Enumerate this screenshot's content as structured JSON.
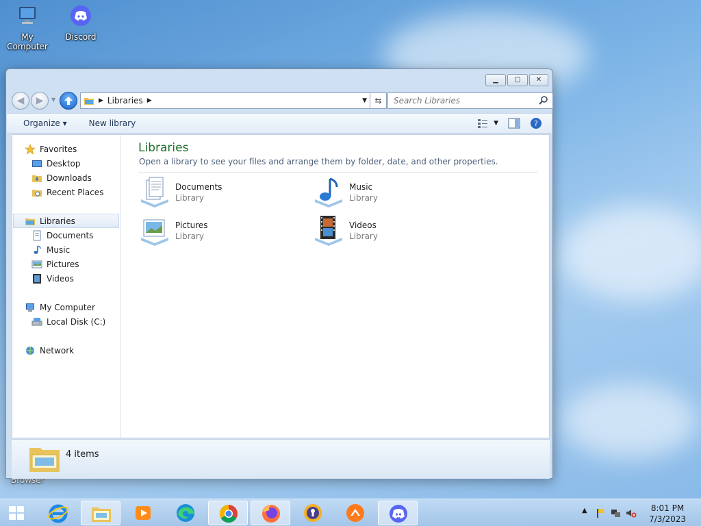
{
  "desktop": {
    "icons": [
      {
        "label": "My Computer"
      },
      {
        "label": "Discord"
      }
    ],
    "partial_label": "Browser"
  },
  "window": {
    "address": {
      "crumb": "Libraries"
    },
    "search_placeholder": "Search Libraries",
    "toolbar": {
      "organize": "Organize ▾",
      "new_library": "New library"
    },
    "nav": {
      "favorites": "Favorites",
      "desktop": "Desktop",
      "downloads": "Downloads",
      "recent_places": "Recent Places",
      "libraries": "Libraries",
      "documents": "Documents",
      "music": "Music",
      "pictures": "Pictures",
      "videos": "Videos",
      "my_computer": "My Computer",
      "local_disk": "Local Disk (C:)",
      "network": "Network"
    },
    "main": {
      "title": "Libraries",
      "subtitle": "Open a library to see your files and arrange them by folder, date, and other properties.",
      "libraries": [
        {
          "name": "Documents",
          "type": "Library"
        },
        {
          "name": "Music",
          "type": "Library"
        },
        {
          "name": "Pictures",
          "type": "Library"
        },
        {
          "name": "Videos",
          "type": "Library"
        }
      ]
    },
    "status": {
      "count": "4 items"
    }
  },
  "taskbar": {
    "clock": {
      "time": "8:01 PM",
      "date": "7/3/2023"
    },
    "apps": [
      "internet-explorer",
      "file-explorer",
      "media-player",
      "edge",
      "chrome",
      "firefox",
      "keepass",
      "sublime",
      "discord"
    ]
  },
  "colors": {
    "title_green": "#1e6e2b",
    "accent_blue": "#1560c4"
  }
}
